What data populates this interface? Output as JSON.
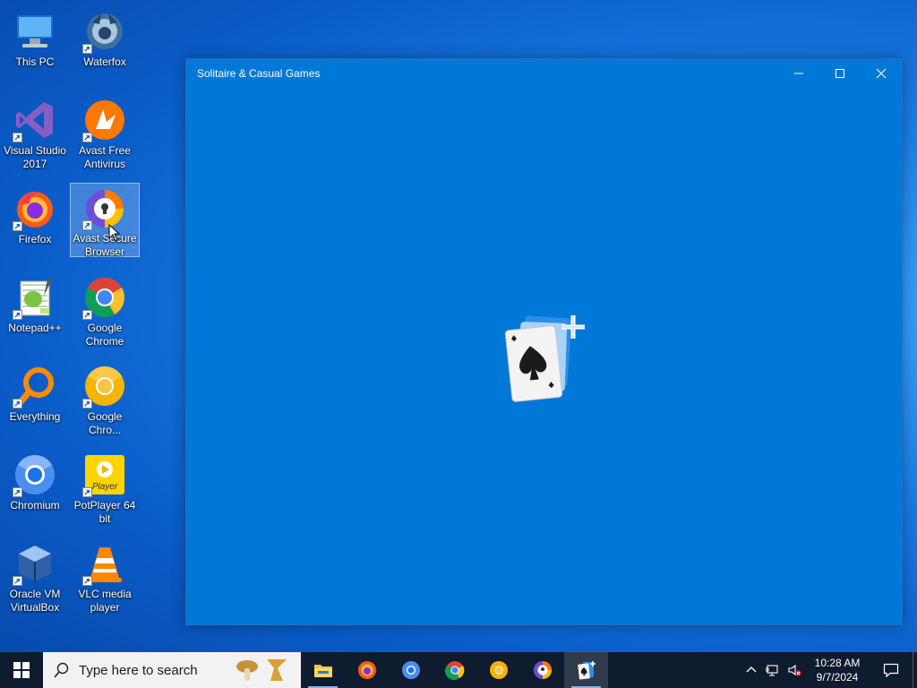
{
  "desktop": {
    "icons": [
      {
        "label": "This PC"
      },
      {
        "label": "Waterfox"
      },
      {
        "label": "Visual Studio 2017"
      },
      {
        "label": "Avast Free Antivirus"
      },
      {
        "label": "Firefox"
      },
      {
        "label": "Avast Secure Browser"
      },
      {
        "label": "Notepad++"
      },
      {
        "label": "Google Chrome"
      },
      {
        "label": "Everything"
      },
      {
        "label": "Google Chro..."
      },
      {
        "label": "Chromium"
      },
      {
        "label": "PotPlayer 64 bit"
      },
      {
        "label": "Oracle VM VirtualBox"
      },
      {
        "label": "VLC media player"
      }
    ]
  },
  "window": {
    "title": "Solitaire & Casual Games",
    "background": "#0078d7",
    "splash_icon": "solitaire-spade-cards-icon"
  },
  "taskbar": {
    "search_placeholder": "Type here to search",
    "apps": [
      {
        "name": "file-explorer-icon"
      },
      {
        "name": "firefox-icon"
      },
      {
        "name": "chromium-icon"
      },
      {
        "name": "chrome-icon"
      },
      {
        "name": "chrome-canary-icon"
      },
      {
        "name": "avast-secure-browser-icon"
      },
      {
        "name": "solitaire-icon",
        "active": true
      }
    ],
    "clock": {
      "time": "10:28 AM",
      "date": "9/7/2024"
    }
  }
}
